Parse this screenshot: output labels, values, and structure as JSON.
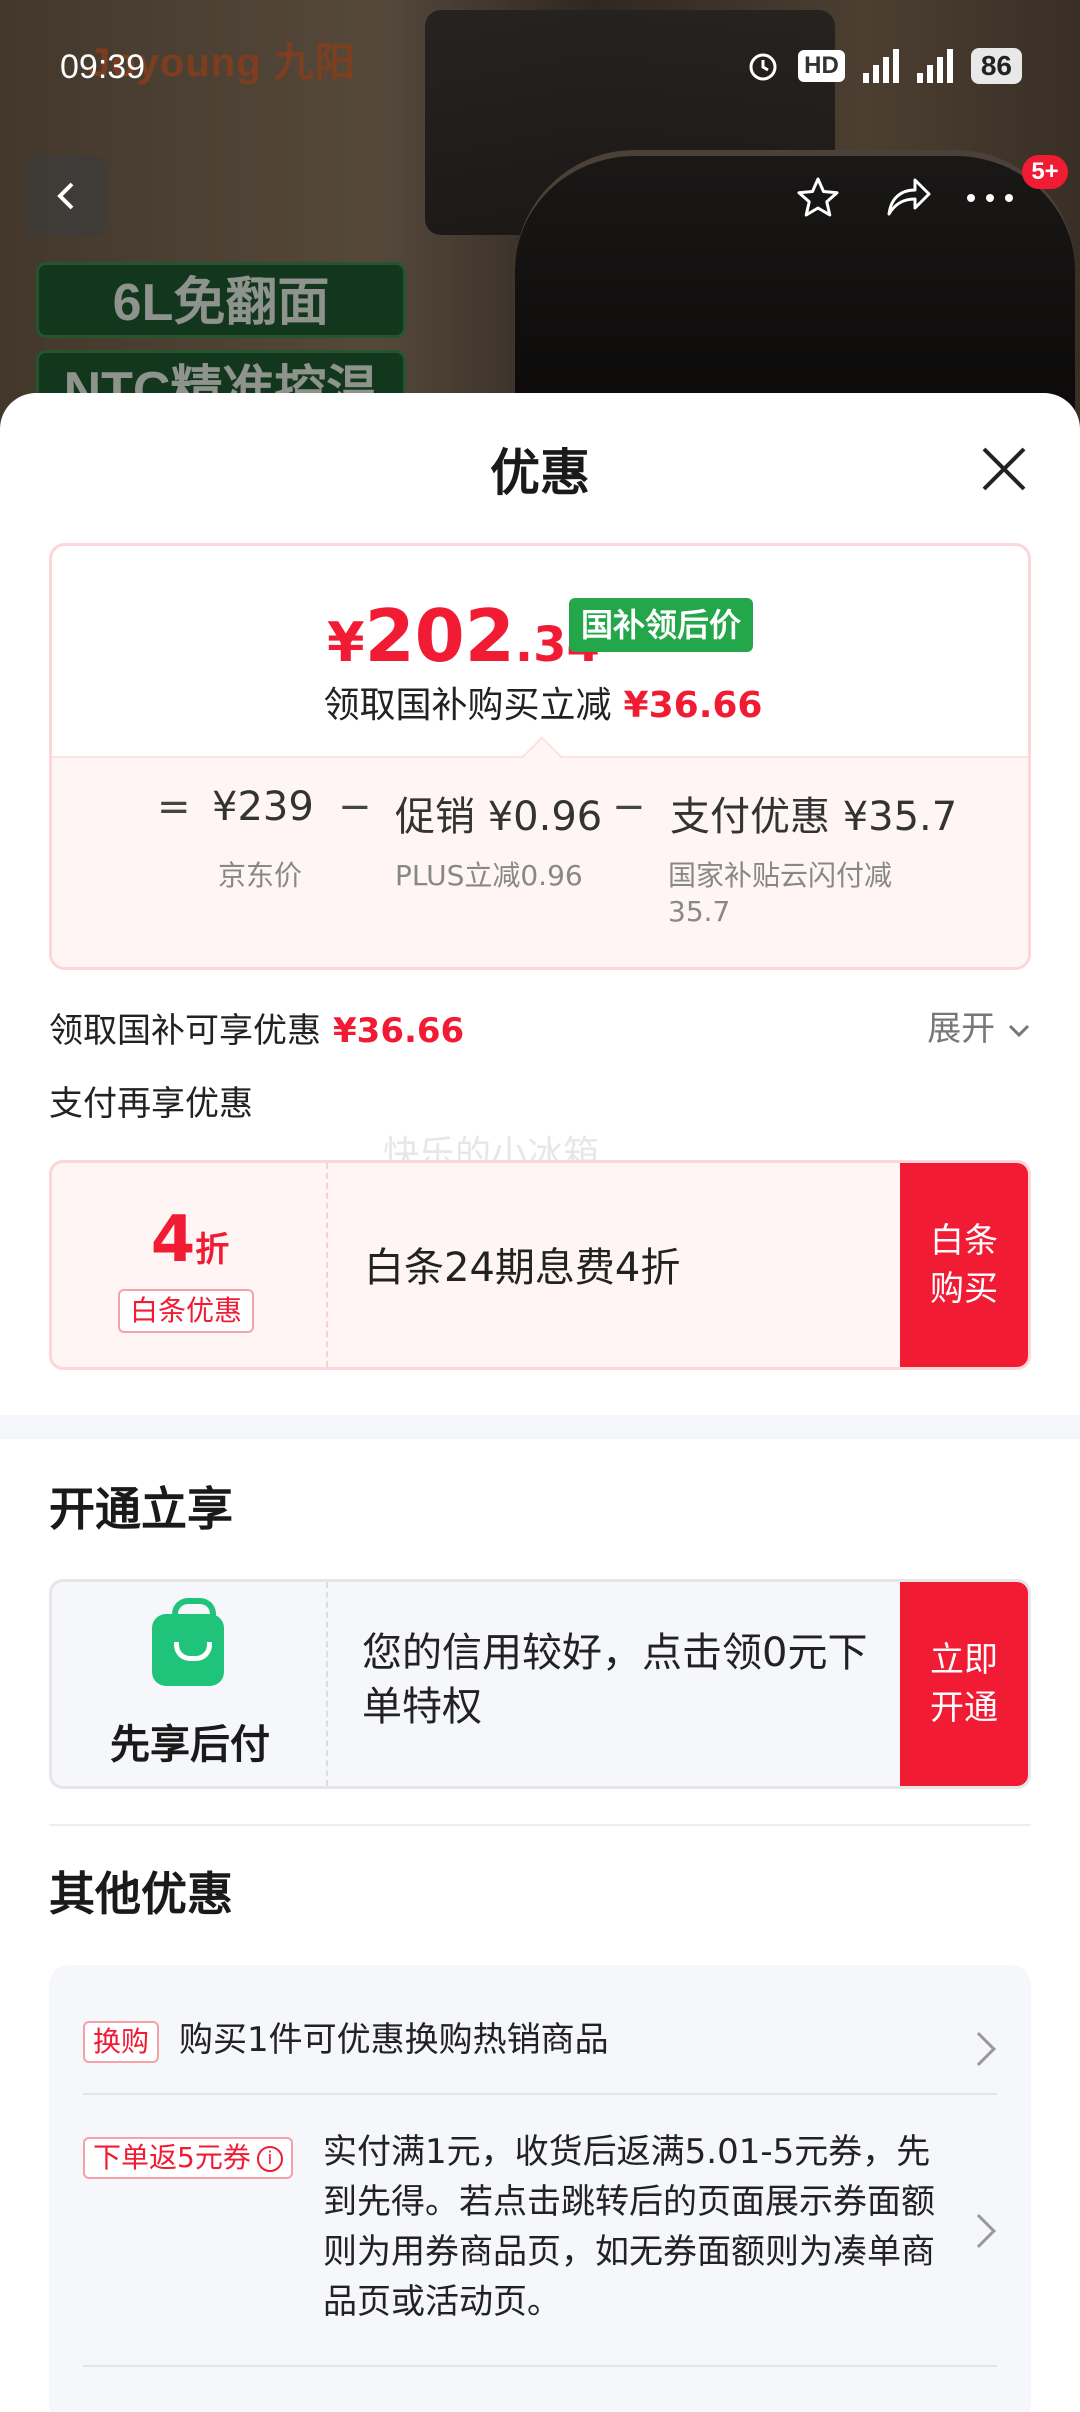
{
  "status_bar": {
    "time": "09:39",
    "hd_label": "HD",
    "battery": "86"
  },
  "hero": {
    "brand": "Joyoung 九阳",
    "tag1": "6L免翻面",
    "tag2": "NTC精准控温"
  },
  "nav": {
    "back_icon": "chevron-left-icon",
    "favorite_icon": "star-icon",
    "share_icon": "share-icon",
    "more_icon": "more-icon",
    "badge": "5+"
  },
  "sheet": {
    "title": "优惠",
    "close_icon": "close-icon"
  },
  "price_card": {
    "currency": "¥",
    "price_int": "202",
    "price_dec": ".34",
    "price_tag": "国补领后价",
    "subtitle": "领取国补购买立减",
    "subtitle_amount": "¥36.66",
    "breakdown": {
      "eq": "=",
      "minus": "−",
      "jd_price": "¥239",
      "jd_caption": "京东价",
      "promo": "促销 ¥0.96",
      "promo_caption": "PLUS立减0.96",
      "pay": "支付优惠 ¥35.7",
      "pay_caption_1": "国家补贴云闪付减",
      "pay_caption_2": "35.7"
    }
  },
  "subsidy_row": {
    "label": "领取国补可享优惠",
    "amount": "¥36.66",
    "expand": "展开"
  },
  "pay_more_label": "支付再享优惠",
  "watermark": "快乐的小冰箱",
  "ious": {
    "rate_num": "4",
    "rate_unit": "折",
    "badge": "白条优惠",
    "text": "白条24期息费4折",
    "button": "白条购买"
  },
  "open_section": {
    "title": "开通立享",
    "bnpl_name": "先享后付",
    "text": "您的信用较好，点击领0元下单特权",
    "button": "立即开通"
  },
  "other_section": {
    "title": "其他优惠",
    "rows": [
      {
        "tag": "换购",
        "text": "购买1件可优惠换购热销商品"
      },
      {
        "tag": "下单返5元券",
        "text": "实付满1元，收货后返满5.01-5元券，先到先得。若点击跳转后的页面展示券面额则为用券商品页，如无券面额则为凑单商品页或活动页。"
      }
    ]
  },
  "colors": {
    "accent_red": "#f21b34",
    "subsidy_green": "#24a74a",
    "bnpl_green": "#1fc47a"
  }
}
